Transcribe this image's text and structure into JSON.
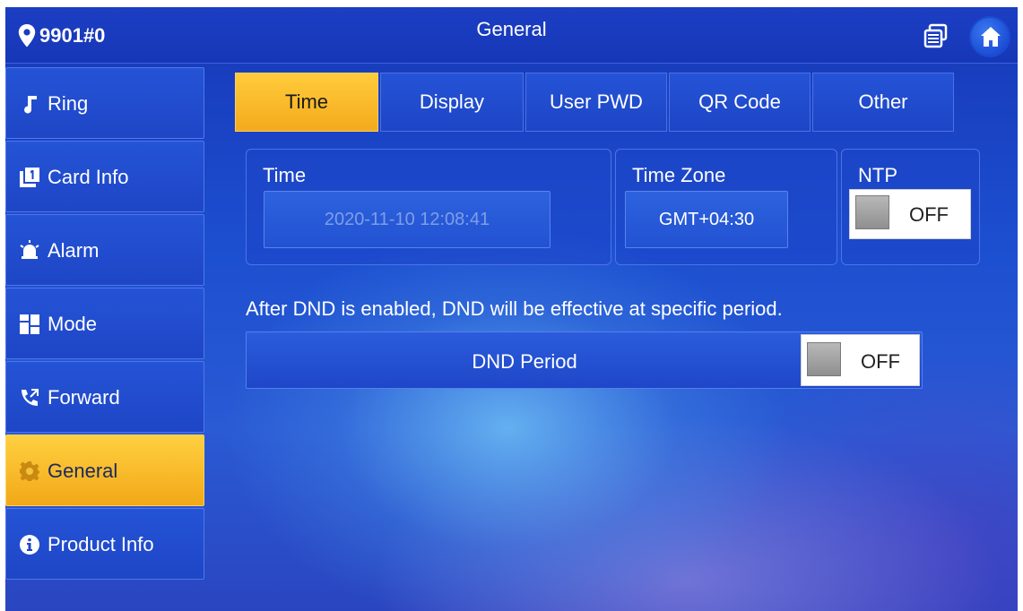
{
  "topbar": {
    "room": "9901#0",
    "title": "General"
  },
  "sidebar": {
    "items": [
      {
        "label": "Ring",
        "icon": "music-note-icon"
      },
      {
        "label": "Card Info",
        "icon": "card-icon"
      },
      {
        "label": "Alarm",
        "icon": "alarm-icon"
      },
      {
        "label": "Mode",
        "icon": "mode-icon"
      },
      {
        "label": "Forward",
        "icon": "forward-call-icon"
      },
      {
        "label": "General",
        "icon": "gear-icon",
        "active": true
      },
      {
        "label": "Product Info",
        "icon": "info-icon"
      }
    ]
  },
  "tabs": [
    {
      "label": "Time",
      "active": true
    },
    {
      "label": "Display"
    },
    {
      "label": "User PWD"
    },
    {
      "label": "QR Code"
    },
    {
      "label": "Other"
    }
  ],
  "time_panel": {
    "label": "Time",
    "value": "2020-11-10 12:08:41"
  },
  "timezone_panel": {
    "label": "Time Zone",
    "value": "GMT+04:30"
  },
  "ntp_panel": {
    "label": "NTP",
    "state": "OFF"
  },
  "dnd": {
    "hint": "After DND is enabled, DND will be effective at specific period.",
    "label": "DND Period",
    "state": "OFF"
  },
  "colors": {
    "accent": "#f4b020",
    "background": "#1c45c8",
    "panel_border": "#4b74e6"
  }
}
